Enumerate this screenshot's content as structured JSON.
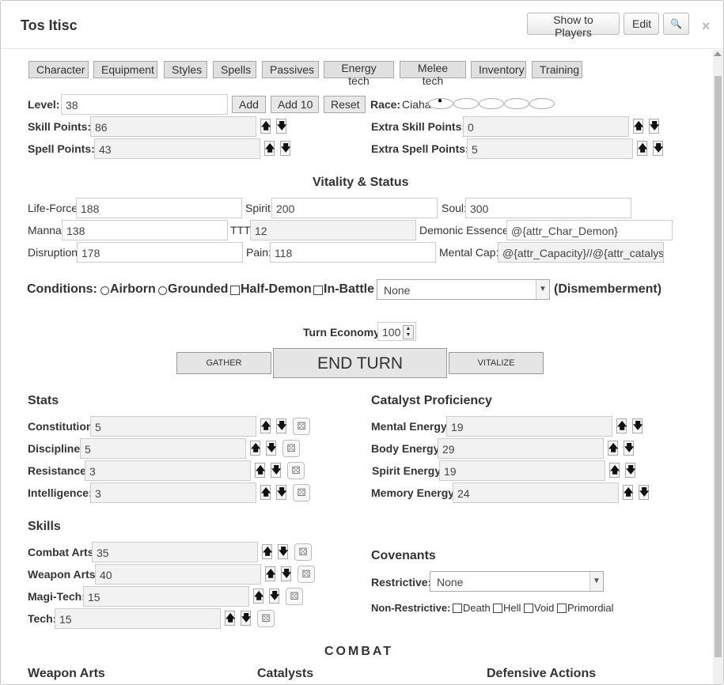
{
  "window": {
    "title": "Tos Itisc",
    "show_to_players": "Show to Players",
    "edit": "Edit",
    "search_glyph": "🔍",
    "close_glyph": "×"
  },
  "tabs": [
    "Character",
    "Equipment",
    "Styles",
    "Spells",
    "Passives",
    "Energy tech",
    "Melee tech",
    "Inventory",
    "Training"
  ],
  "level": {
    "label": "Level:",
    "value": "38",
    "add": "Add",
    "add10": "Add 10",
    "reset": "Reset"
  },
  "race": {
    "label": "Race:",
    "value": "Ciaha",
    "dot": "●"
  },
  "skill_points": {
    "label": "Skill Points:",
    "value": "86"
  },
  "spell_points": {
    "label": "Spell Points:",
    "value": "43"
  },
  "extra_skill_points": {
    "label": "Extra Skill Points:",
    "value": "0"
  },
  "extra_spell_points": {
    "label": "Extra Spell Points:",
    "value": "5"
  },
  "arrows": {
    "up": "🡅",
    "down": "🡇"
  },
  "vitality": {
    "heading": "Vitality & Status",
    "life_force": {
      "label": "Life-Force:",
      "value": "188"
    },
    "spirit": {
      "label": "Spirit:",
      "value": "200"
    },
    "soul": {
      "label": "Soul:",
      "value": "300"
    },
    "manna": {
      "label": "Manna:",
      "value": "138"
    },
    "ttt": {
      "label": "TTT:",
      "value": "12"
    },
    "demonic_essence": {
      "label": "Demonic Essence:",
      "value": "@{attr_Char_Demon}"
    },
    "disruption": {
      "label": "Disruption:",
      "value": "178"
    },
    "pain": {
      "label": "Pain:",
      "value": "118"
    },
    "mental_cap": {
      "label": "Mental Cap:",
      "value": "@{attr_Capacity}//@{attr_catalyst_"
    }
  },
  "conditions": {
    "label": "Conditions:",
    "airborne": "Airborn",
    "grounded": "Grounded",
    "half_demon": "Half-Demon",
    "in_battle": "In-Battle",
    "dismemberment_value": "None",
    "dismemberment_label": "(Dismemberment)"
  },
  "turn": {
    "economy_label": "Turn Economy:",
    "economy_value": "100",
    "gather": "GATHER",
    "end_turn": "END TURN",
    "vitalize": "VITALIZE"
  },
  "stats": {
    "heading": "Stats",
    "items": [
      {
        "label": "Constitution:",
        "value": "5"
      },
      {
        "label": "Discipline:",
        "value": "5"
      },
      {
        "label": "Resistance:",
        "value": "3"
      },
      {
        "label": "Intelligence:",
        "value": "3"
      }
    ]
  },
  "catalyst": {
    "heading": "Catalyst Proficiency",
    "items": [
      {
        "label": "Mental Energy:",
        "value": "19"
      },
      {
        "label": "Body Energy:",
        "value": "29"
      },
      {
        "label": "Spirit Energy:",
        "value": "19"
      },
      {
        "label": "Memory Energy:",
        "value": "24"
      }
    ]
  },
  "skills": {
    "heading": "Skills",
    "items": [
      {
        "label": "Combat Arts:",
        "value": "35"
      },
      {
        "label": "Weapon Arts:",
        "value": "40"
      },
      {
        "label": "Magi-Tech:",
        "value": "15"
      },
      {
        "label": "Tech:",
        "value": "15"
      }
    ]
  },
  "covenants": {
    "heading": "Covenants",
    "restrictive_label": "Restrictive:",
    "restrictive_value": "None",
    "non_restrictive_label": "Non-Restrictive:",
    "options": [
      "Death",
      "Hell",
      "Void",
      "Primordial"
    ]
  },
  "combat": {
    "heading": "COMBAT",
    "weapon_arts": "Weapon Arts",
    "catalysts": "Catalysts",
    "defensive_actions": "Defensive Actions"
  },
  "icons": {
    "dice": "⚄",
    "caret": "▼"
  }
}
